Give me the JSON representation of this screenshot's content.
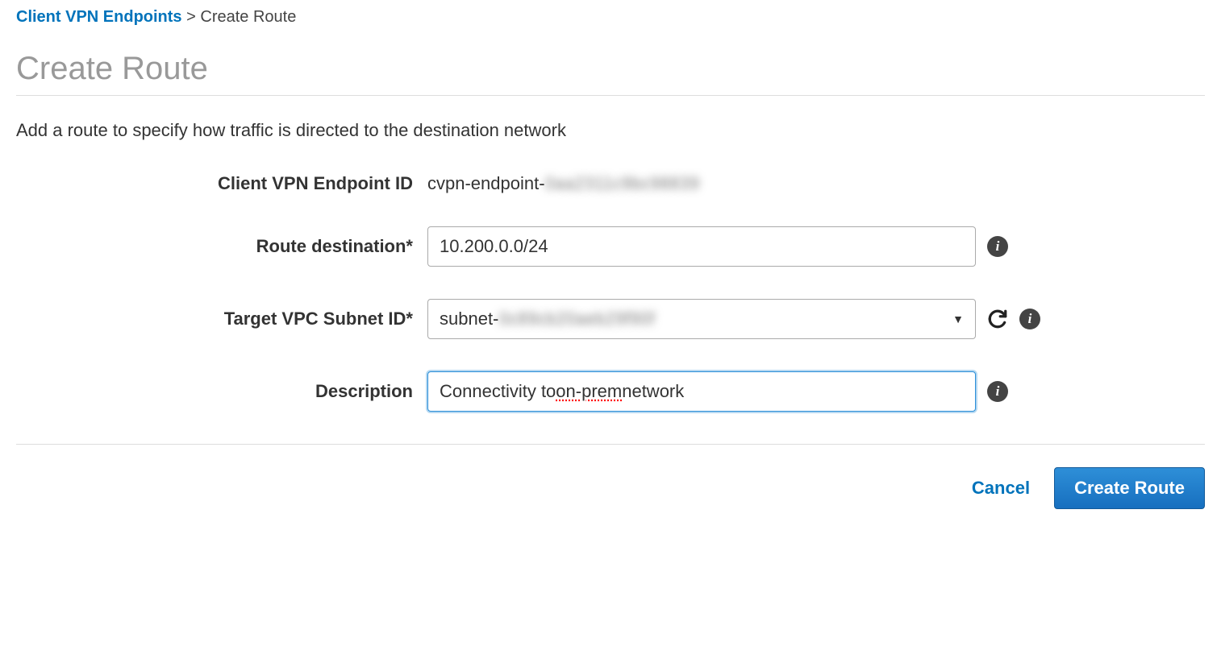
{
  "breadcrumb": {
    "parent": "Client VPN Endpoints",
    "separator": ">",
    "current": "Create Route"
  },
  "page_title": "Create Route",
  "intro_text": "Add a route to specify how traffic is directed to the destination network",
  "form": {
    "endpoint_id": {
      "label": "Client VPN Endpoint ID",
      "value_prefix": "cvpn-endpoint-",
      "value_obscured": "0aa2311c9bc98839"
    },
    "route_destination": {
      "label": "Route destination*",
      "value": "10.200.0.0/24"
    },
    "target_subnet": {
      "label": "Target VPC Subnet ID*",
      "value_prefix": "subnet-",
      "value_obscured": "0c89cb20aeb29f90f"
    },
    "description": {
      "label": "Description",
      "value_pre": "Connectivity to ",
      "value_spell": "on-prem",
      "value_post": " network"
    }
  },
  "footer": {
    "cancel": "Cancel",
    "submit": "Create Route"
  }
}
